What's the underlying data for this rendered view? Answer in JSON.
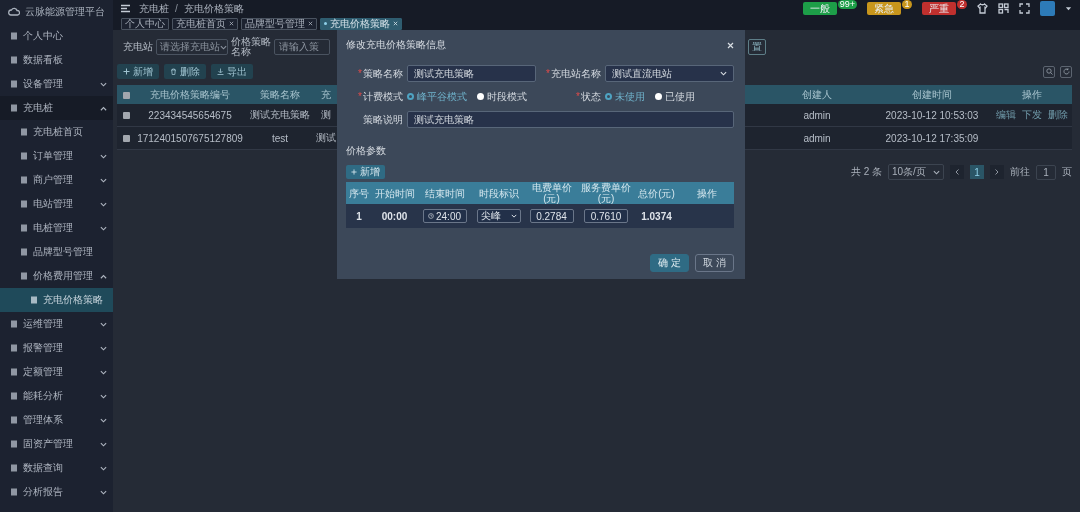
{
  "sidebar": {
    "title": "云脉能源管理平台",
    "items": [
      {
        "label": "个人中心",
        "selected": false
      },
      {
        "label": "数据看板",
        "selected": false
      },
      {
        "label": "设备管理",
        "selected": false,
        "expanded": false
      },
      {
        "label": "充电桩",
        "selected": false,
        "expanded": true,
        "children": [
          {
            "label": "充电桩首页",
            "selected": false
          },
          {
            "label": "订单管理",
            "selected": false,
            "expanded": false
          },
          {
            "label": "商户管理",
            "selected": false,
            "expanded": false
          },
          {
            "label": "电站管理",
            "selected": false,
            "expanded": false
          },
          {
            "label": "电桩管理",
            "selected": false,
            "expanded": false
          },
          {
            "label": "品牌型号管理",
            "selected": false
          },
          {
            "label": "价格费用管理",
            "selected": false,
            "expanded": true,
            "children": [
              {
                "label": "充电价格策略",
                "selected": true
              }
            ]
          }
        ]
      },
      {
        "label": "运维管理",
        "selected": false,
        "expanded": false
      },
      {
        "label": "报警管理",
        "selected": false,
        "expanded": false
      },
      {
        "label": "定额管理",
        "selected": false,
        "expanded": false
      },
      {
        "label": "能耗分析",
        "selected": false,
        "expanded": false
      },
      {
        "label": "管理体系",
        "selected": false,
        "expanded": false
      },
      {
        "label": "固资产管理",
        "selected": false,
        "expanded": false
      },
      {
        "label": "数据查询",
        "selected": false,
        "expanded": false
      },
      {
        "label": "分析报告",
        "selected": false,
        "expanded": false
      }
    ]
  },
  "header": {
    "breadcrumb": [
      "充电桩",
      "充电价格策略"
    ],
    "breadcrumb_separator": "/",
    "alerts": [
      {
        "label": "一般",
        "count": "99+",
        "color": "#1d9e48"
      },
      {
        "label": "紧急",
        "count": "1",
        "color": "#c8961c"
      },
      {
        "label": "严重",
        "count": "2",
        "color": "#c0302e"
      }
    ]
  },
  "tabs": [
    {
      "label": "个人中心",
      "selected": false,
      "closable": false
    },
    {
      "label": "充电桩首页",
      "selected": false,
      "closable": true
    },
    {
      "label": "品牌型号管理",
      "selected": false,
      "closable": true
    },
    {
      "label": "充电价格策略",
      "selected": true,
      "closable": true
    }
  ],
  "filters": {
    "station_label": "充电站",
    "station_placeholder": "请选择充电站",
    "name_label": "价格策略名称",
    "name_placeholder": "请输入策",
    "reset_button": "置"
  },
  "toolbar": {
    "buttons": [
      "新增",
      "删除",
      "导出"
    ]
  },
  "table": {
    "header_checked": false,
    "columns": [
      "充电价格策略编号",
      "策略名称",
      "充",
      "创建人",
      "创建时间",
      "操作"
    ],
    "rows": [
      {
        "checked": false,
        "cells": [
          "223434545654675",
          "测试充电策略",
          "测",
          "admin",
          "2023-10-12 10:53:03"
        ],
        "actions": [
          "编辑",
          "下发",
          "删除"
        ]
      },
      {
        "checked": false,
        "cells": [
          "1712401507675127809",
          "test",
          "测试",
          "admin",
          "2023-10-12 17:35:09"
        ]
      }
    ]
  },
  "pagination": {
    "total": "共 2 条",
    "page_size": "10条/页",
    "pages": [
      {
        "label": "1",
        "selected": true
      }
    ],
    "goto_label": "前往",
    "goto_value": "1",
    "goto_suffix": "页"
  },
  "dialog": {
    "title": "修改充电价格策略信息",
    "required_mark": "*",
    "fields": [
      {
        "kind": "input",
        "label": "策略名称",
        "required": true,
        "value": "测试充电策略"
      },
      {
        "kind": "select",
        "label": "充电站名称",
        "required": true,
        "value": "测试直流电站"
      },
      {
        "kind": "radio",
        "label": "计费模式",
        "required": true,
        "options": [
          {
            "label": "峰平谷模式",
            "selected": true
          },
          {
            "label": "时段模式",
            "selected": false
          }
        ]
      },
      {
        "kind": "radio",
        "label": "状态",
        "required": true,
        "options": [
          {
            "label": "未使用",
            "selected": true
          },
          {
            "label": "已使用",
            "selected": false
          }
        ]
      },
      {
        "kind": "textarea",
        "label": "策略说明",
        "required": false,
        "value": "测试充电策略"
      }
    ],
    "section_title": "价格参数",
    "add_button": "新增",
    "price_table": {
      "columns": [
        "序号",
        "开始时间",
        "结束时间",
        "时段标识",
        "电费单价(元)",
        "服务费单价(元)",
        "总价(元)",
        "操作"
      ],
      "rows": [
        {
          "cells": [
            {
              "kind": "text",
              "value": "1"
            },
            {
              "kind": "text",
              "value": "00:00"
            },
            {
              "kind": "time",
              "value": "24:00"
            },
            {
              "kind": "select",
              "value": "尖峰"
            },
            {
              "kind": "input",
              "value": "0.2784"
            },
            {
              "kind": "input",
              "value": "0.7610"
            },
            {
              "kind": "text",
              "value": "1.0374"
            }
          ]
        }
      ]
    },
    "buttons": [
      {
        "label": "确 定",
        "kind": "primary"
      },
      {
        "label": "取 消",
        "kind": "default"
      }
    ]
  }
}
